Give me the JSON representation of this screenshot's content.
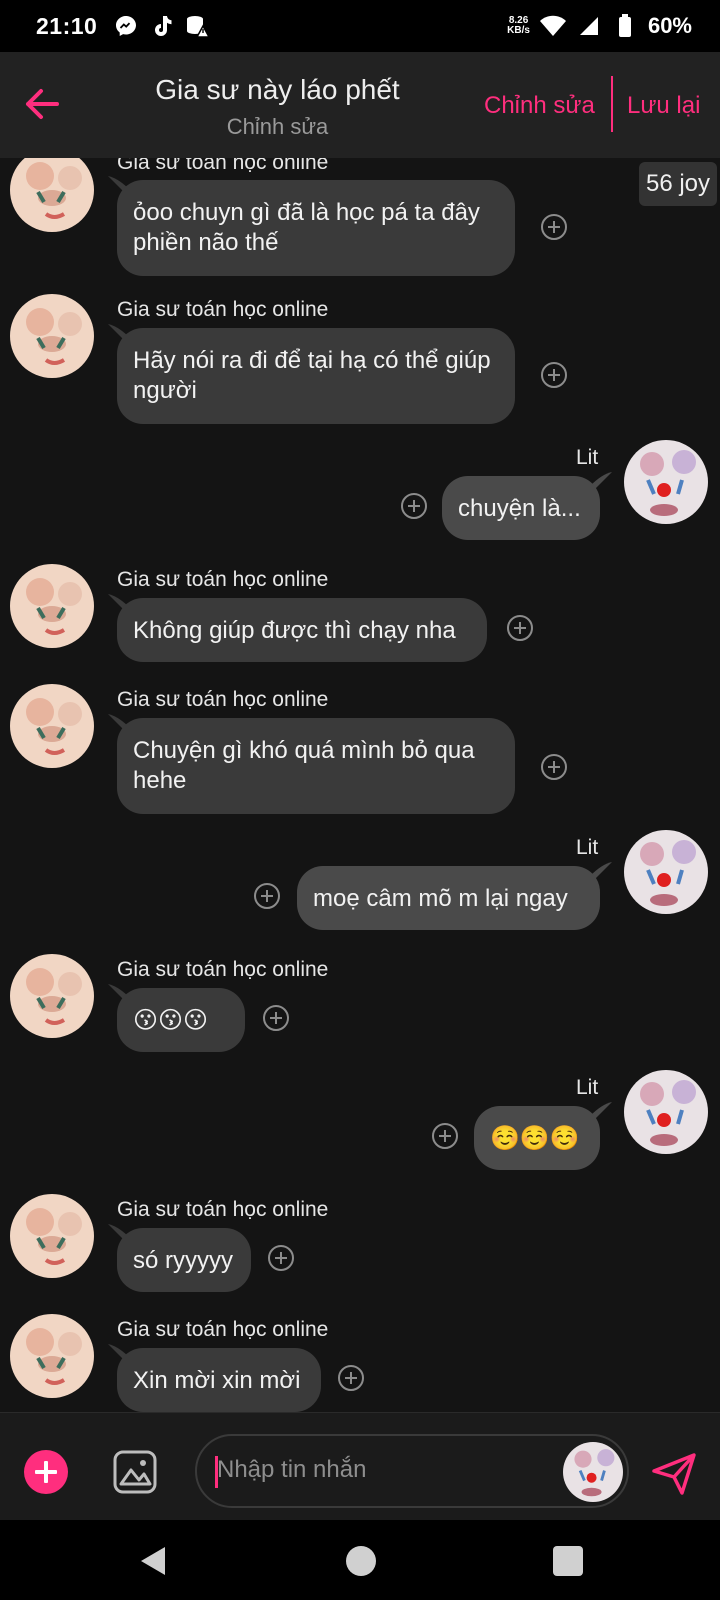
{
  "status_bar": {
    "time": "21:10",
    "icons": [
      "messenger-icon",
      "tiktok-icon",
      "data-alert-icon"
    ],
    "net_speed_value": "8.26",
    "net_speed_unit": "KB/s",
    "battery": "60%"
  },
  "header": {
    "title": "Gia sư này láo phết",
    "subtitle": "Chỉnh sửa",
    "edit_label": "Chỉnh sửa",
    "save_label": "Lưu lại"
  },
  "joy_badge": "56 joy",
  "messages": [
    {
      "side": "left",
      "sender": "Gia sư toán học online",
      "text": "ỏoo chuyn gì đã là học pá ta đây phiền não thế"
    },
    {
      "side": "left",
      "sender": "Gia sư toán học online",
      "text": "Hãy nói ra đi để tại hạ có thể giúp người"
    },
    {
      "side": "right",
      "sender": "Lit",
      "text": "chuyện là..."
    },
    {
      "side": "left",
      "sender": "Gia sư toán học online",
      "text": "Không giúp được thì chạy nha"
    },
    {
      "side": "left",
      "sender": "Gia sư toán học online",
      "text": "Chuyện gì khó quá mình bỏ qua hehe"
    },
    {
      "side": "right",
      "sender": "Lit",
      "text": "moẹ câm mõ m lại ngay"
    },
    {
      "side": "left",
      "sender": "Gia sư toán học online",
      "text": "😗😗😗"
    },
    {
      "side": "right",
      "sender": "Lit",
      "text": "☺️☺️☺️"
    },
    {
      "side": "left",
      "sender": "Gia sư toán học online",
      "text": "só ryyyyy"
    },
    {
      "side": "left",
      "sender": "Gia sư toán học online",
      "text": "Xin mời xin mời"
    }
  ],
  "input": {
    "placeholder": "Nhập tin nhắn"
  },
  "colors": {
    "accent": "#ff2e7e",
    "background": "#141414",
    "header": "#222222",
    "bubble": "#3a3a3a"
  }
}
